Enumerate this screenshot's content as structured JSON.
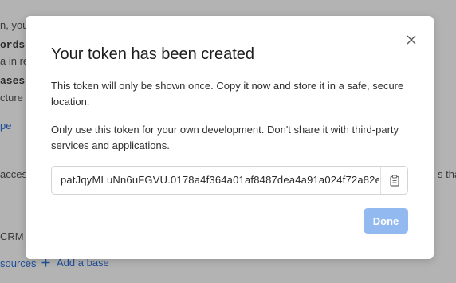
{
  "background": {
    "lines": [
      {
        "text": "n, you",
        "style": "plain"
      },
      {
        "text": "ords:",
        "style": "mono"
      },
      {
        "text": "a in re",
        "style": "plain"
      },
      {
        "text": "ases:",
        "style": "mono"
      },
      {
        "text": "cture",
        "style": "plain"
      },
      {
        "text": "pe",
        "style": "link"
      },
      {
        "text": "acces",
        "style": "plain"
      },
      {
        "text": "s that",
        "style": "plain"
      },
      {
        "text": "CRM",
        "style": "plain"
      }
    ],
    "sources_link": "sources",
    "add_base_label": "Add a base"
  },
  "modal": {
    "title": "Your token has been created",
    "paragraph_1": "This token will only be shown once. Copy it now and store it in a safe, secure location.",
    "paragraph_2": "Only use this token for your own development. Don't share it with third-party services and applications.",
    "token_value": "patJqyMLuNn6uFGVU.0178a4f364a01af8487dea4a91a024f72a82e",
    "copy_icon": "clipboard-icon",
    "close_icon": "close-icon",
    "done_label": "Done"
  },
  "colors": {
    "overlay": "#b3b3b3",
    "modal_bg": "#ffffff",
    "done_button": "#93b9f1",
    "link": "#1f4f9a"
  }
}
